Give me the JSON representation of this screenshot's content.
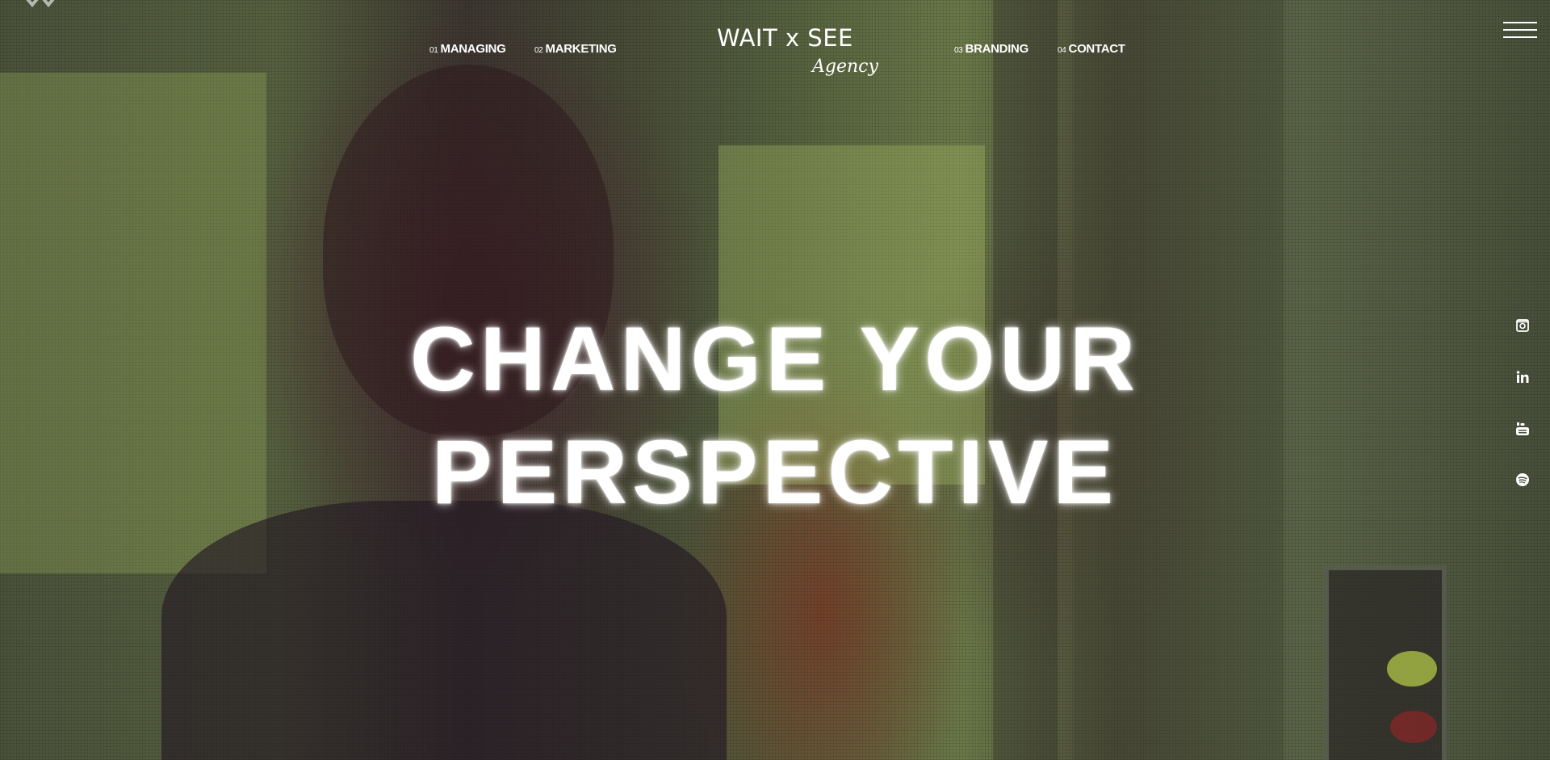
{
  "nav": {
    "items": [
      {
        "number": "01",
        "label": "MANAGING"
      },
      {
        "number": "02",
        "label": "MARKETING"
      },
      {
        "number": "03",
        "label": "BRANDING"
      },
      {
        "number": "04",
        "label": "CONTACT"
      }
    ]
  },
  "brand": {
    "name": "WAIT x SEE",
    "tagline": "Agency"
  },
  "hero": {
    "headline_line1": "CHANGE YOUR",
    "headline_line2": "PERSPECTIVE"
  },
  "icons": {
    "menu": "hamburger-menu-icon",
    "social": [
      "instagram-icon",
      "linkedin-icon",
      "youtube-icon",
      "spotify-icon"
    ]
  },
  "colors": {
    "text": "#ffffff",
    "overlay_tint": "#4a523a"
  }
}
